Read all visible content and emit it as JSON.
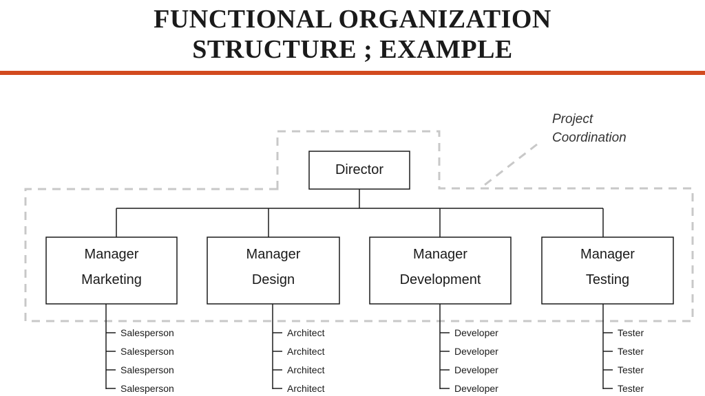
{
  "title": {
    "line1": "FUNCTIONAL ORGANIZATION",
    "line2": "STRUCTURE ; EXAMPLE"
  },
  "colors": {
    "accent_rule": "#d24a1f",
    "box_stroke": "#1a1a1a",
    "dashed_outline": "#c8c8c8"
  },
  "annotation": {
    "line1": "Project",
    "line2": "Coordination"
  },
  "director": {
    "label": "Director"
  },
  "managers": [
    {
      "line1": "Manager",
      "line2": "Marketing",
      "staff": [
        "Salesperson",
        "Salesperson",
        "Salesperson",
        "Salesperson"
      ]
    },
    {
      "line1": "Manager",
      "line2": "Design",
      "staff": [
        "Architect",
        "Architect",
        "Architect",
        "Architect"
      ]
    },
    {
      "line1": "Manager",
      "line2": "Development",
      "staff": [
        "Developer",
        "Developer",
        "Developer",
        "Developer"
      ]
    },
    {
      "line1": "Manager",
      "line2": "Testing",
      "staff": [
        "Tester",
        "Tester",
        "Tester",
        "Tester"
      ]
    }
  ]
}
